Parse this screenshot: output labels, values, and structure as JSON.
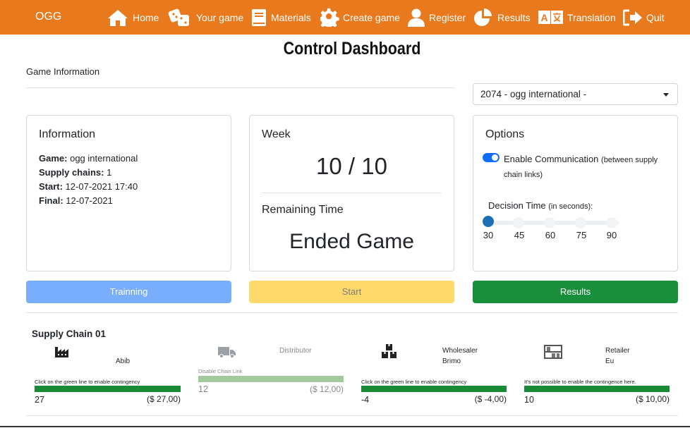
{
  "nav": {
    "brand": "OGG",
    "items": [
      {
        "label": "Home",
        "icon": "home-icon"
      },
      {
        "label": "Your game",
        "icon": "dice-icon"
      },
      {
        "label": "Materials",
        "icon": "book-icon"
      },
      {
        "label": "Create game",
        "icon": "gear-icon"
      },
      {
        "label": "Register",
        "icon": "user-icon"
      },
      {
        "label": "Results",
        "icon": "pie-chart-icon"
      },
      {
        "label": "Translation",
        "icon": "translate-icon"
      },
      {
        "label": "Quit",
        "icon": "sign-out-icon"
      }
    ]
  },
  "page": {
    "title": "Control Dashboard",
    "section_label": "Game Information",
    "game_select": "2074 - ogg international -"
  },
  "info_card": {
    "title": "Information",
    "game_label": "Game:",
    "game_value": "ogg international",
    "chains_label": "Supply chains:",
    "chains_value": "1",
    "start_label": "Start:",
    "start_value": "12-07-2021 17:40",
    "final_label": "Final:",
    "final_value": "12-07-2021"
  },
  "week_card": {
    "title": "Week",
    "week_value": "10 / 10",
    "remaining_title": "Remaining Time",
    "status": "Ended Game"
  },
  "options_card": {
    "title": "Options",
    "communication_label": "Enable Communication",
    "communication_note": "(between supply chain links)",
    "communication_enabled": true,
    "decision_label": "Decision Time",
    "decision_note": "(in seconds):",
    "ticks": [
      "30",
      "45",
      "60",
      "75",
      "90"
    ],
    "selected": "30"
  },
  "buttons": {
    "training": "Trainning",
    "start": "Start",
    "results": "Results"
  },
  "supply_chain": {
    "title": "Supply Chain 01",
    "links": [
      {
        "icon": "factory-icon",
        "role": "",
        "name": "Abib",
        "note": "Click on the green line to enable contingency",
        "count": "27",
        "cost": "($ 27,00)"
      },
      {
        "icon": "truck-icon",
        "role": "Distributor",
        "name": "",
        "note": "Disable Chain Link",
        "count": "12",
        "cost": "($ 12,00)"
      },
      {
        "icon": "boxes-icon",
        "role": "Wholesaler",
        "name": "Brimo",
        "note": "Click on the green line to enable contingency",
        "count": "-4",
        "cost": "($ -4,00)"
      },
      {
        "icon": "store-icon",
        "role": "Retailer",
        "name": "Eu",
        "note": "It's not possible to enable the contingence here.",
        "count": "10",
        "cost": "($ 10,00)"
      }
    ]
  },
  "colors": {
    "navbar": "#e8791d",
    "training_button": "#79aefd",
    "start_button": "#ffda6a",
    "results_button": "#198f3c",
    "contingency_bar": "#198a35",
    "disabled_bar": "#a3ca9c",
    "slider_handle": "#1a6fb5"
  }
}
